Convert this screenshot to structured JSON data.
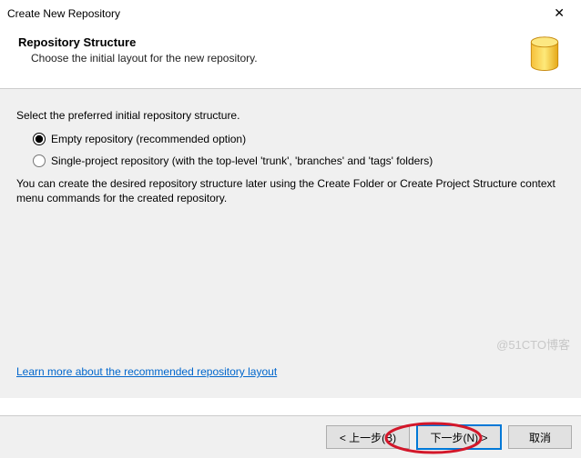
{
  "titlebar": {
    "title": "Create New Repository",
    "close_glyph": "✕"
  },
  "header": {
    "heading": "Repository Structure",
    "subheading": "Choose the initial layout for the new repository."
  },
  "content": {
    "prompt": "Select the preferred initial repository structure.",
    "options": {
      "empty": "Empty repository (recommended option)",
      "single": "Single-project repository (with the top-level 'trunk', 'branches' and 'tags' folders)"
    },
    "note": "You can create the desired repository structure later using the Create Folder or Create Project Structure context menu commands for the created repository.",
    "link": "Learn more about the recommended repository layout"
  },
  "footer": {
    "back": "< 上一步(B)",
    "next": "下一步(N) >",
    "cancel": "取消"
  },
  "watermark": "@51CTO博客"
}
